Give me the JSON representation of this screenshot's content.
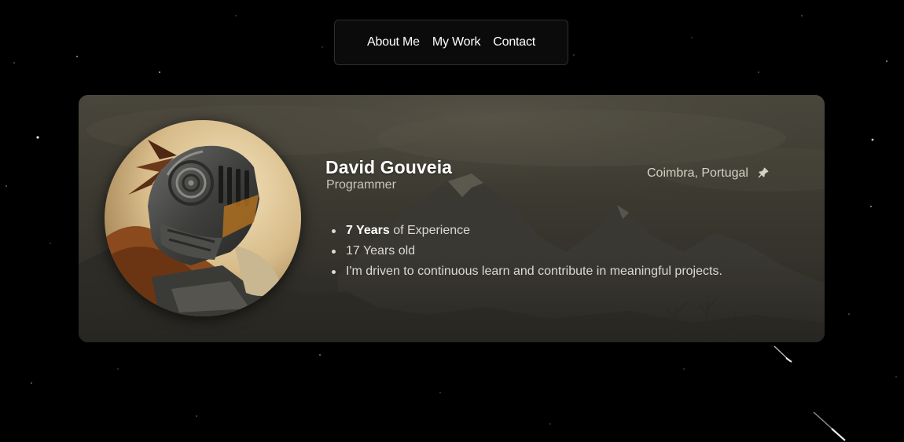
{
  "nav": {
    "items": [
      {
        "label": "About Me"
      },
      {
        "label": "My Work"
      },
      {
        "label": "Contact"
      }
    ]
  },
  "profile": {
    "name": "David Gouveia",
    "role": "Programmer",
    "location": "Coimbra, Portugal",
    "location_icon": "pin-icon",
    "avatar_icon": "knight-helmet-avatar",
    "facts": [
      {
        "strong": "7 Years",
        "text": " of Experience"
      },
      {
        "strong": "",
        "text": "17 Years old"
      },
      {
        "strong": "",
        "text": "I'm driven to continuous learn and contribute in meaningful projects."
      }
    ]
  },
  "colors": {
    "page_background": "#000000",
    "nav_background": "#0b0b0b",
    "nav_border": "#2e2e2e",
    "card_tint": "#2f2d27",
    "text_primary": "#ffffff",
    "text_muted": "#c9c6bd"
  }
}
